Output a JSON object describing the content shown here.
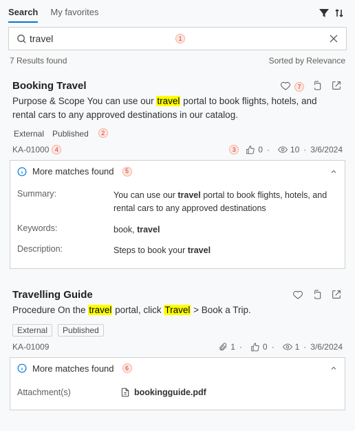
{
  "tabs": {
    "search": "Search",
    "favorites": "My favorites"
  },
  "search": {
    "value": "travel",
    "placeholder": "Search"
  },
  "meta": {
    "count_label": "7 Results found",
    "sort_label": "Sorted by Relevance"
  },
  "annotations": {
    "a1": "1",
    "a2": "2",
    "a3": "3",
    "a4": "4",
    "a5": "5",
    "a6": "6",
    "a7": "7"
  },
  "results": [
    {
      "title": "Booking Travel",
      "snippet_pre": "Purpose & Scope You can use our ",
      "snippet_mark": "travel",
      "snippet_post": " portal to book flights, hotels, and rental cars to any approved destinations in our catalog.",
      "tags": {
        "external": "External",
        "published": "Published"
      },
      "tags_boxed": false,
      "id": "KA-01000",
      "likes": "0",
      "views": "10",
      "date": "3/6/2024",
      "more_header": "More matches found",
      "kv": {
        "summary_k": "Summary:",
        "summary_v_pre": "You can use our ",
        "summary_v_b1": "travel",
        "summary_v_post": " portal to book flights, hotels, and rental cars to any approved destinations",
        "keywords_k": "Keywords:",
        "keywords_v_pre": "book, ",
        "keywords_v_b": "travel",
        "description_k": "Description:",
        "description_v_pre": "Steps to book your ",
        "description_v_b": "travel"
      }
    },
    {
      "title": "Travelling Guide",
      "snippet_pre": "Procedure On the ",
      "snippet_m1": "travel",
      "snippet_mid": " portal, click ",
      "snippet_m2": "Travel",
      "snippet_post": " > Book a Trip.",
      "tags": {
        "external": "External",
        "published": "Published"
      },
      "tags_boxed": true,
      "id": "KA-01009",
      "attach_count": "1",
      "likes": "0",
      "views": "1",
      "date": "3/6/2024",
      "more_header": "More matches found",
      "attach": {
        "key": "Attachment(s)",
        "filename": "bookingguide.pdf"
      }
    }
  ]
}
